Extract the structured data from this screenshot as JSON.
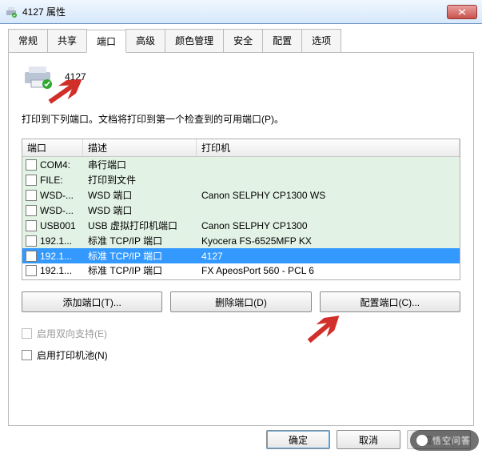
{
  "titlebar": {
    "title": "4127 属性"
  },
  "tabs": {
    "items": [
      "常规",
      "共享",
      "端口",
      "高级",
      "颜色管理",
      "安全",
      "配置",
      "选项"
    ],
    "active_index": 2
  },
  "printer": {
    "name": "4127"
  },
  "description": "打印到下列端口。文档将打印到第一个检查到的可用端口(P)。",
  "grid": {
    "headers": {
      "port": "端口",
      "desc": "描述",
      "printer": "打印机"
    },
    "rows": [
      {
        "checked": false,
        "port": "COM4:",
        "desc": "串行端口",
        "printer": ""
      },
      {
        "checked": false,
        "port": "FILE:",
        "desc": "打印到文件",
        "printer": ""
      },
      {
        "checked": false,
        "port": "WSD-...",
        "desc": "WSD 端口",
        "printer": "Canon SELPHY CP1300 WS"
      },
      {
        "checked": false,
        "port": "WSD-...",
        "desc": "WSD 端口",
        "printer": ""
      },
      {
        "checked": false,
        "port": "USB001",
        "desc": "USB 虚拟打印机端口",
        "printer": "Canon SELPHY CP1300"
      },
      {
        "checked": false,
        "port": "192.1...",
        "desc": "标准 TCP/IP 端口",
        "printer": "Kyocera FS-6525MFP KX"
      },
      {
        "checked": true,
        "port": "192.1...",
        "desc": "标准 TCP/IP 端口",
        "printer": "4127",
        "selected": true
      },
      {
        "checked": false,
        "port": "192.1...",
        "desc": "标准 TCP/IP 端口",
        "printer": "FX ApeosPort 560 - PCL 6",
        "last": true
      }
    ]
  },
  "buttons": {
    "add": "添加端口(T)...",
    "delete": "删除端口(D)",
    "config": "配置端口(C)..."
  },
  "checks": {
    "bidir": "启用双向支持(E)",
    "pool": "启用打印机池(N)"
  },
  "footer": {
    "ok": "确定",
    "cancel": "取消",
    "apply": "应用(A)"
  }
}
